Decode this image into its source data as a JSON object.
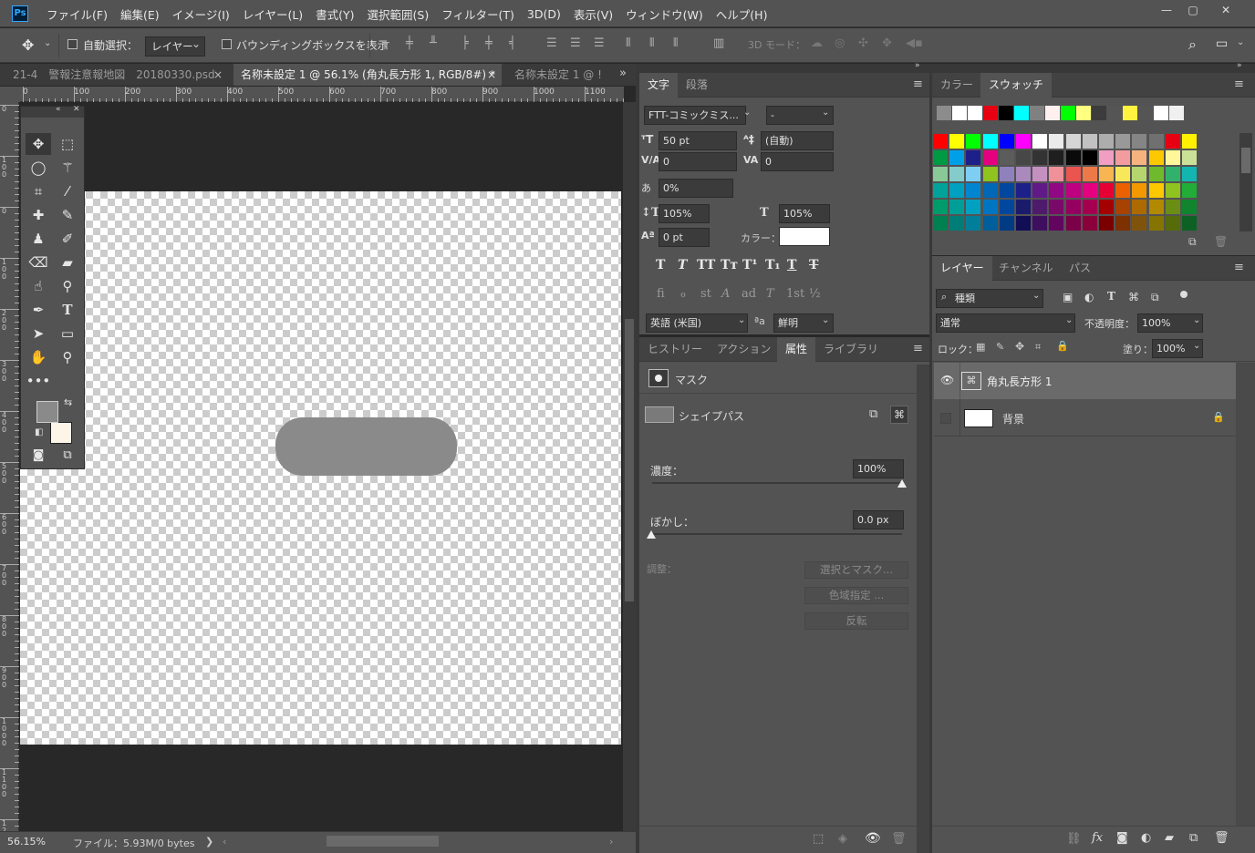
{
  "app": {
    "logo": "Ps"
  },
  "menu": [
    "ファイル(F)",
    "編集(E)",
    "イメージ(I)",
    "レイヤー(L)",
    "書式(Y)",
    "選択範囲(S)",
    "フィルター(T)",
    "3D(D)",
    "表示(V)",
    "ウィンドウ(W)",
    "ヘルプ(H)"
  ],
  "window_controls": {
    "minimize": "—",
    "maximize": "▢",
    "close": "✕"
  },
  "options": {
    "auto_select_label": "自動選択：",
    "auto_select_target": "レイヤー",
    "bounding_box_label": "バウンディングボックスを表示",
    "mode_3d_label": "3D モード："
  },
  "doc_tabs": [
    {
      "label": "21-4　警報注意報地図　20180330.psd",
      "close": "×"
    },
    {
      "label": "名称未設定 1 @ 56.1% (角丸長方形 1, RGB/8#) *",
      "close": "×"
    },
    {
      "label": "名称未設定 1 @ !",
      "close": ""
    }
  ],
  "tabs_overflow": "»",
  "ruler_h": [
    "0",
    "100",
    "200",
    "300",
    "400",
    "500",
    "600",
    "700",
    "800",
    "900",
    "1000",
    "1100"
  ],
  "ruler_v": [
    "0",
    "1 0 0",
    "0",
    "1 0 0",
    "2 0 0",
    "3 0 0",
    "4 0 0",
    "5 0 0",
    "6 0 0",
    "7 0 0",
    "8 0 0",
    "9 0 0",
    "1 0 0 0",
    "1 1 0 0",
    "1 2 0 0"
  ],
  "status": {
    "zoom": "56.15%",
    "file_info": "ファイル：5.93M/0 bytes",
    "arrow": "❯"
  },
  "character_panel": {
    "tabs": [
      "文字",
      "段落"
    ],
    "font_family": "FTT-コミックミス...",
    "font_style": "-",
    "size": "50 pt",
    "leading": "(自動)",
    "kerning": "0",
    "tracking": "0",
    "tsume": "0%",
    "vscale": "105%",
    "hscale": "105%",
    "baseline": "0 pt",
    "color_label": "カラー：",
    "format_buttons": [
      "T",
      "T",
      "TT",
      "Tт",
      "T¹",
      "T₁",
      "T",
      "T"
    ],
    "opentype_buttons": [
      "fi",
      "ℴ",
      "st",
      "A",
      "ad",
      "T",
      "1st",
      "½"
    ],
    "language": "英語 (米国)",
    "aa_icon": "ªa",
    "antialias": "鮮明"
  },
  "properties_panel": {
    "tabs": [
      "ヒストリー",
      "アクション",
      "属性",
      "ライブラリ"
    ],
    "mask_label": "マスク",
    "shape_path_label": "シェイプパス",
    "density_label": "濃度：",
    "density_value": "100%",
    "density": 1.0,
    "feather_label": "ぼかし：",
    "feather_value": "0.0 px",
    "adjust_label": "調整：",
    "buttons": [
      "選択とマスク...",
      "色域指定 ...",
      "反転"
    ]
  },
  "swatches_panel": {
    "tabs": [
      "カラー",
      "スウォッチ"
    ],
    "recent": [
      "#8c8c8c",
      "#ffffff",
      "#ffffff",
      "#e60012",
      "#000000",
      "#00ffff",
      "#808080",
      "#fff0f0",
      "#00ff00",
      "#ffff80",
      "#3c3c3c",
      "#555555",
      "#fff340",
      "#555555",
      "#ffffff",
      "#f0f0f0"
    ],
    "grid": [
      [
        "#ff0000",
        "#ffff00",
        "#00ff00",
        "#00ffff",
        "#0000ff",
        "#ff00ff",
        "#ffffff",
        "#ebebeb",
        "#d6d6d6",
        "#c2c2c2",
        "#adadad",
        "#999999",
        "#858585",
        "#707070",
        "#e60012",
        "#fff100"
      ],
      [
        "#009944",
        "#00a0e9",
        "#1d2088",
        "#e4007f",
        "#5c5c5c",
        "#474747",
        "#333333",
        "#1f1f1f",
        "#0a0a0a",
        "#000000",
        "#f19ec2",
        "#f29c9f",
        "#f6b37f",
        "#fcc800",
        "#fff799",
        "#cce198"
      ],
      [
        "#89c997",
        "#84ccc9",
        "#7ecef4",
        "#8fc31f",
        "#8f82bc",
        "#aa89bd",
        "#c490bf",
        "#f09199",
        "#ea5550",
        "#ee7948",
        "#f8b551",
        "#f8e75b",
        "#b6d56f",
        "#6fba2c",
        "#32b16c",
        "#13b5b1"
      ],
      [
        "#00a29a",
        "#00a0c1",
        "#0086d1",
        "#0068b7",
        "#00479d",
        "#1d2088",
        "#601986",
        "#920783",
        "#be0081",
        "#e4007f",
        "#e60033",
        "#eb6100",
        "#f39800",
        "#fcc800",
        "#8fc31f",
        "#22ac38"
      ],
      [
        "#009b6b",
        "#009e96",
        "#00a0c1",
        "#0075c2",
        "#00479d",
        "#1b1b6b",
        "#4e1a6b",
        "#7a0a6a",
        "#950060",
        "#a4004f",
        "#a40000",
        "#a84200",
        "#ac6a00",
        "#b28900",
        "#6a8e14",
        "#10852e"
      ],
      [
        "#007f51",
        "#007d77",
        "#007e9a",
        "#005f9a",
        "#003b84",
        "#110e55",
        "#3f0f5f",
        "#62055f",
        "#7a0048",
        "#8a003a",
        "#7a0000",
        "#7e3100",
        "#80530c",
        "#857500",
        "#566b0a",
        "#0d6125"
      ]
    ]
  },
  "layers_panel": {
    "tabs": [
      "レイヤー",
      "チャンネル",
      "パス"
    ],
    "filter_label": "種類",
    "blend_mode": "通常",
    "opacity_label": "不透明度：",
    "opacity_value": "100%",
    "lock_label": "ロック：",
    "fill_label": "塗り：",
    "fill_value": "100%",
    "layers": [
      {
        "name": "角丸長方形 1",
        "visible": true,
        "selected": true
      },
      {
        "name": "背景",
        "visible": false,
        "locked": true
      }
    ]
  }
}
